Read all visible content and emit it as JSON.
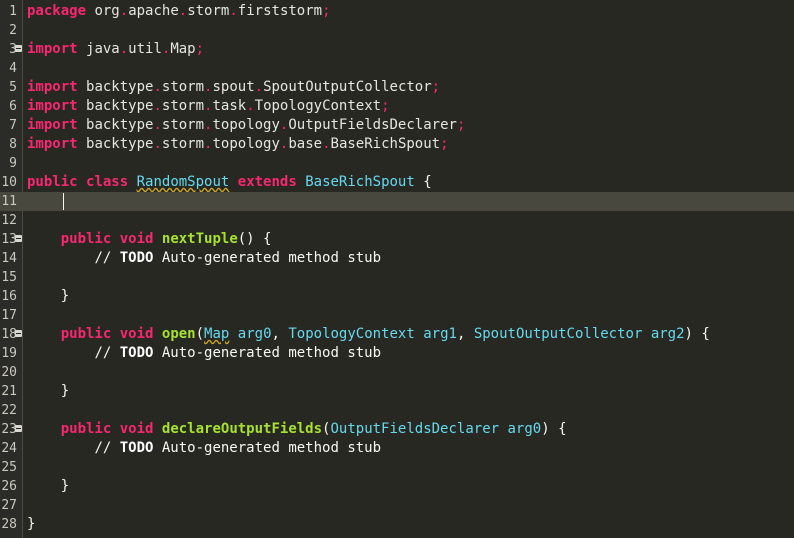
{
  "editor": {
    "line_numbers": [
      "1",
      "2",
      "3",
      "4",
      "5",
      "6",
      "7",
      "8",
      "9",
      "10",
      "11",
      "12",
      "13",
      "14",
      "15",
      "16",
      "17",
      "18",
      "19",
      "20",
      "21",
      "22",
      "23",
      "24",
      "25",
      "26",
      "27",
      "28"
    ],
    "keywords": {
      "package": "package",
      "import": "import",
      "public": "public",
      "class": "class",
      "extends": "extends",
      "void": "void"
    },
    "package_name": [
      "org",
      ".",
      "apache",
      ".",
      "storm",
      ".",
      "firststorm"
    ],
    "semi": ";",
    "imports": [
      [
        "java",
        ".",
        "util",
        ".",
        "Map"
      ],
      [
        "backtype",
        ".",
        "storm",
        ".",
        "spout",
        ".",
        "SpoutOutputCollector"
      ],
      [
        "backtype",
        ".",
        "storm",
        ".",
        "task",
        ".",
        "TopologyContext"
      ],
      [
        "backtype",
        ".",
        "storm",
        ".",
        "topology",
        ".",
        "OutputFieldsDeclarer"
      ],
      [
        "backtype",
        ".",
        "storm",
        ".",
        "topology",
        ".",
        "base",
        ".",
        "BaseRichSpout"
      ]
    ],
    "class_name": "RandomSpout",
    "super_class": "BaseRichSpout",
    "open_brace": "{",
    "close_brace": "}",
    "methods": [
      {
        "name": "nextTuple",
        "params_text": "() {"
      },
      {
        "name": "open",
        "p_open": "(",
        "type1": "Map",
        "arg0": "arg0",
        "comma": ", ",
        "type2": "TopologyContext",
        "arg1": "arg1",
        "type3": "SpoutOutputCollector",
        "arg2": "arg2",
        "p_close": ") {"
      },
      {
        "name": "declareOutputFields",
        "p_open": "(",
        "type1": "OutputFieldsDeclarer",
        "arg0": "arg0",
        "p_close": ") {"
      }
    ],
    "comment_prefix": "// ",
    "todo": "TODO",
    "comment_text": " Auto-generated method stub",
    "current_line": "11"
  }
}
